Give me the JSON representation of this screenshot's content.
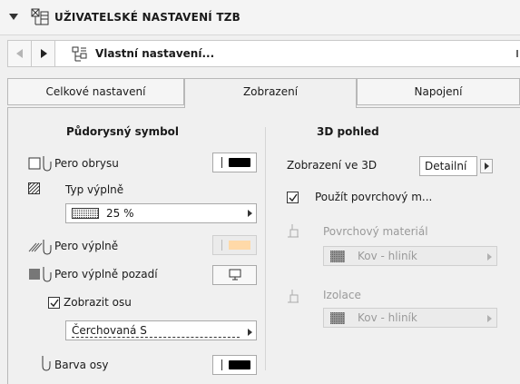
{
  "header": {
    "title": "UŽIVATELSKÉ NASTAVENÍ TZB"
  },
  "nav": {
    "preset_label": "Vlastní nastavení..."
  },
  "tabs": [
    {
      "label": "Celkové nastavení"
    },
    {
      "label": "Zobrazení"
    },
    {
      "label": "Napojení"
    }
  ],
  "left": {
    "heading": "Půdorysný symbol",
    "pen_outline_label": "Pero obrysu",
    "fill_type_label": "Typ výplně",
    "fill_type_value": "25 %",
    "fill_pen_label": "Pero výplně",
    "fill_bg_pen_label": "Pero výplně pozadí",
    "show_axis_label": "Zobrazit osu",
    "axis_line_value": "Čerchovaná S",
    "axis_color_label": "Barva osy"
  },
  "right": {
    "heading": "3D pohled",
    "display3d_label": "Zobrazení ve 3D",
    "display3d_value": "Detailní",
    "use_surface_label": "Použít povrchový m...",
    "surface_material_label": "Povrchový materiál",
    "surface_material_value": "Kov - hliník",
    "insulation_label": "Izolace",
    "insulation_value": "Kov - hliník"
  },
  "colors": {
    "fill_pen_swatch": "#ffd9a8",
    "pen_black": "#000000"
  }
}
